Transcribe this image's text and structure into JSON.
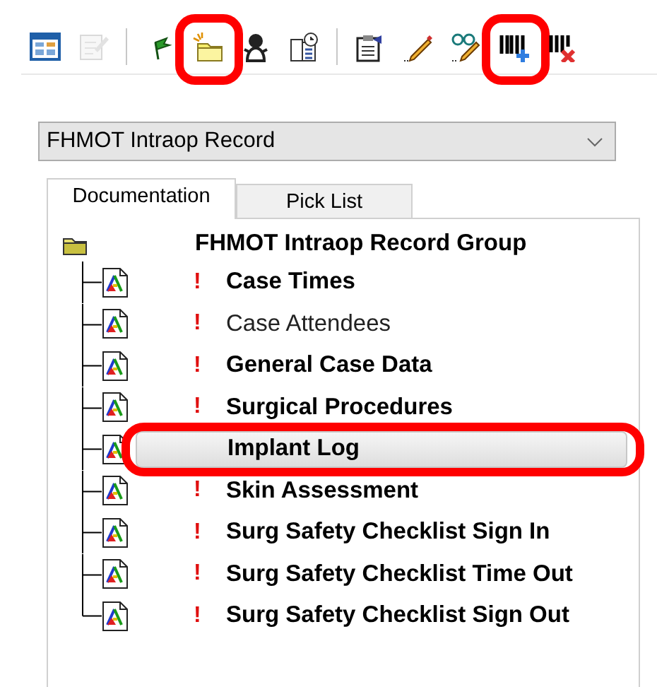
{
  "toolbar": {
    "items": [
      {
        "kind": "layout",
        "disabled": false,
        "highlighted": false
      },
      {
        "kind": "form",
        "disabled": true,
        "highlighted": false
      },
      {
        "kind": "separator"
      },
      {
        "kind": "flag",
        "disabled": false,
        "highlighted": false
      },
      {
        "kind": "folder",
        "disabled": false,
        "highlighted": true
      },
      {
        "kind": "figure",
        "disabled": false,
        "highlighted": false
      },
      {
        "kind": "book",
        "disabled": false,
        "highlighted": false
      },
      {
        "kind": "separator"
      },
      {
        "kind": "clipboard",
        "disabled": false,
        "highlighted": false
      },
      {
        "kind": "pencil",
        "disabled": false,
        "highlighted": false
      },
      {
        "kind": "glasses",
        "disabled": false,
        "highlighted": false
      },
      {
        "kind": "barcode-add",
        "disabled": false,
        "highlighted": true
      },
      {
        "kind": "barcode-delete",
        "disabled": false,
        "highlighted": false
      }
    ]
  },
  "dropdown": {
    "value": "FHMOT Intraop Record"
  },
  "tabs": [
    {
      "label": "Documentation",
      "selected": true
    },
    {
      "label": "Pick List",
      "selected": false
    }
  ],
  "tree": {
    "root": {
      "label": "FHMOT Intraop Record Group",
      "children": [
        {
          "label": "Case Times",
          "flag": "!",
          "bold": true,
          "selected": false,
          "highlighted": false
        },
        {
          "label": "Case Attendees",
          "flag": "!",
          "bold": false,
          "selected": false,
          "highlighted": false
        },
        {
          "label": "General Case Data",
          "flag": "!",
          "bold": true,
          "selected": false,
          "highlighted": false
        },
        {
          "label": "Surgical Procedures",
          "flag": "!",
          "bold": true,
          "selected": false,
          "highlighted": false
        },
        {
          "label": "Implant Log",
          "bold": true,
          "selected": true,
          "highlighted": true
        },
        {
          "label": "Skin Assessment",
          "flag": "!",
          "bold": true,
          "selected": false,
          "highlighted": false
        },
        {
          "label": "Surg Safety Checklist Sign In",
          "flag": "!",
          "bold": true,
          "selected": false,
          "highlighted": false
        },
        {
          "label": "Surg Safety Checklist Time Out",
          "flag": "!",
          "bold": true,
          "selected": false,
          "highlighted": false
        },
        {
          "label": "Surg Safety Checklist Sign Out",
          "flag": "!",
          "bold": true,
          "selected": false,
          "highlighted": false
        }
      ]
    }
  }
}
